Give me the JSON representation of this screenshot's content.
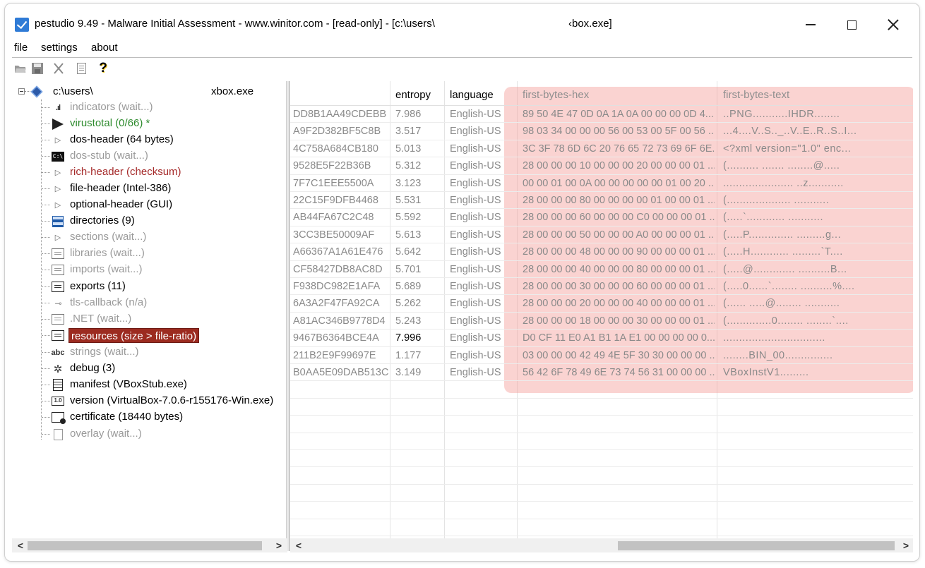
{
  "window": {
    "title": "pestudio 9.49 - Malware Initial Assessment - www.winitor.com - [read-only] - [c:\\users\\",
    "title_suffix": "‹box.exe]"
  },
  "menu": {
    "file": "file",
    "settings": "settings",
    "about": "about"
  },
  "toolbar": {
    "help_glyph": "?"
  },
  "tree": {
    "root_path": "c:\\users\\",
    "root_file": "xbox.exe",
    "nodes": [
      {
        "label": "indicators (wait...)",
        "icon": "bars-icon",
        "status": "wait"
      },
      {
        "label": "virustotal (0/66) *",
        "icon": "virustotal-icon",
        "status": "green"
      },
      {
        "label": "dos-header (64 bytes)",
        "icon": "triangle-icon",
        "status": "black"
      },
      {
        "label": "dos-stub (wait...)",
        "icon": "terminal-icon",
        "status": "wait"
      },
      {
        "label": "rich-header (checksum)",
        "icon": "triangle-hollow-icon",
        "status": "red"
      },
      {
        "label": "file-header (Intel-386)",
        "icon": "triangle-hollow-icon",
        "status": "black"
      },
      {
        "label": "optional-header (GUI)",
        "icon": "triangle-hollow-icon",
        "status": "black"
      },
      {
        "label": "directories (9)",
        "icon": "directories-icon",
        "status": "black"
      },
      {
        "label": "sections (wait...)",
        "icon": "triangle-hollow-icon",
        "status": "wait"
      },
      {
        "label": "libraries (wait...)",
        "icon": "library-icon",
        "status": "wait"
      },
      {
        "label": "imports (wait...)",
        "icon": "import-icon",
        "status": "wait"
      },
      {
        "label": "exports (11)",
        "icon": "export-icon",
        "status": "black"
      },
      {
        "label": "tls-callback (n/a)",
        "icon": "key-icon",
        "status": "wait"
      },
      {
        "label": ".NET (wait...)",
        "icon": "dotnet-icon",
        "status": "wait"
      },
      {
        "label": "resources (size > file-ratio)",
        "icon": "resources-icon",
        "status": "selected"
      },
      {
        "label": "strings (wait...)",
        "icon": "abc-icon",
        "status": "wait"
      },
      {
        "label": "debug (3)",
        "icon": "bug-icon",
        "status": "black"
      },
      {
        "label": "manifest (VBoxStub.exe)",
        "icon": "manifest-icon",
        "status": "black"
      },
      {
        "label": "version (VirtualBox-7.0.6-r155176-Win.exe)",
        "icon": "version-icon",
        "status": "black"
      },
      {
        "label": "certificate (18440 bytes)",
        "icon": "certificate-icon",
        "status": "black"
      },
      {
        "label": "overlay (wait...)",
        "icon": "page-icon",
        "status": "wait"
      }
    ],
    "version_icon_text": "1.0",
    "terminal_icon_text": "C:\\"
  },
  "table": {
    "headers": {
      "entropy": "entropy",
      "language": "language",
      "first_bytes_hex": "first-bytes-hex",
      "first_bytes_text": "first-bytes-text"
    },
    "rows": [
      {
        "hash": "DD8B1AA49CDEBB",
        "entropy": "7.986",
        "language": "English-US",
        "hex": "89 50 4E 47 0D 0A 1A 0A 00 00 00 0D 4...",
        "text": "..PNG...........IHDR........"
      },
      {
        "hash": "A9F2D382BF5C8B",
        "entropy": "3.517",
        "language": "English-US",
        "hex": "98 03 34 00 00 00 56 00 53 00 5F 00 56 ...",
        "text": "...4....V..S.._..V..E..R..S..I..."
      },
      {
        "hash": "4C758A684CB180",
        "entropy": "5.013",
        "language": "English-US",
        "hex": "3C 3F 78 6D 6C 20 76 65 72 73 69 6F 6E...",
        "text": "<?xml version=\"1.0\" enc..."
      },
      {
        "hash": "9528E5F22B36B",
        "entropy": "5.312",
        "language": "English-US",
        "hex": "28 00 00 00 10 00 00 00 20 00 00 00 01 ...",
        "text": "(.......... ....... ........@....."
      },
      {
        "hash": "7F7C1EEE5500A",
        "entropy": "3.123",
        "language": "English-US",
        "hex": "00 00 01 00 0A 00 00 00 00 00 01 00 20 ...",
        "text": "...................... ..z..........."
      },
      {
        "hash": "22C15F9DFB4468",
        "entropy": "5.531",
        "language": "English-US",
        "hex": "28 00 00 00 80 00 00 00 00 01 00 00 01 ...",
        "text": "(.................... ..........."
      },
      {
        "hash": "AB44FA67C2C48",
        "entropy": "5.592",
        "language": "English-US",
        "hex": "28 00 00 00 60 00 00 00 C0 00 00 00 01 ...",
        "text": "(.....`............ ..........."
      },
      {
        "hash": "3CC3BE50009AF",
        "entropy": "5.613",
        "language": "English-US",
        "hex": "28 00 00 00 50 00 00 00 A0 00 00 00 01 ...",
        "text": "(.....P.............. .........g..."
      },
      {
        "hash": "A66367A1A61E476",
        "entropy": "5.642",
        "language": "English-US",
        "hex": "28 00 00 00 48 00 00 00 90 00 00 00 01 ...",
        "text": "(.....H............ .........`T...."
      },
      {
        "hash": "CF58427DB8AC8D",
        "entropy": "5.701",
        "language": "English-US",
        "hex": "28 00 00 00 40 00 00 00 80 00 00 00 01 ...",
        "text": "(.....@............. ..........B..."
      },
      {
        "hash": "F938DC982E1AFA",
        "entropy": "5.689",
        "language": "English-US",
        "hex": "28 00 00 00 30 00 00 00 60 00 00 00 01 ...",
        "text": "(.....0......`........ ..........%...."
      },
      {
        "hash": "6A3A2F47FA92CA",
        "entropy": "5.262",
        "language": "English-US",
        "hex": "28 00 00 00 20 00 00 00 40 00 00 00 01 ...",
        "text": "(...... .....@........ ..........."
      },
      {
        "hash": "A81AC346B9778D4",
        "entropy": "5.243",
        "language": "English-US",
        "hex": "28 00 00 00 18 00 00 00 30 00 00 00 01 ...",
        "text": "(..............0........ ........`...."
      },
      {
        "hash": "9467B6364BCE4A",
        "entropy": "7.996",
        "language": "English-US",
        "hex": "D0 CF 11 E0 A1 B1 1A E1 00 00 00 00 0...",
        "text": "................................"
      },
      {
        "hash": "211B2E9F99697E",
        "entropy": "1.177",
        "language": "English-US",
        "hex": "03 00 00 00 42 49 4E 5F 30 30 00 00 00 ...",
        "text": "........BIN_00..............."
      },
      {
        "hash": "B0AA5E09DAB513C",
        "entropy": "3.149",
        "language": "English-US",
        "hex": "56 42 6F 78 49 6E 73 74 56 31 00 00 00 ...",
        "text": "VBoxInstV1........."
      }
    ]
  },
  "scrollbars": {
    "left_arrow": "<",
    "right_arrow": ">"
  },
  "colors": {
    "selected_bg": "#9c2b20",
    "highlight": "#f39691",
    "green_status": "#2e8b2e",
    "red_status": "#a52a2a"
  }
}
